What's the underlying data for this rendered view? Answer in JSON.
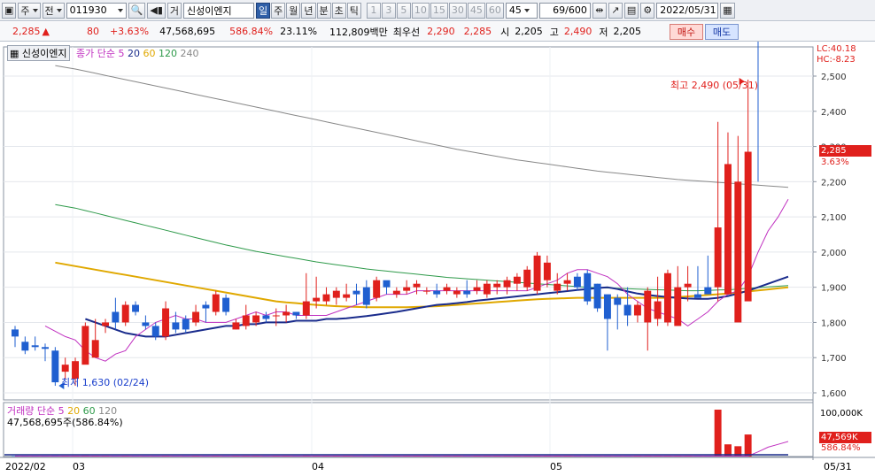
{
  "toolbar": {
    "market_label": "주",
    "type_label": "전",
    "code": "011930",
    "chart_type_label": "거",
    "name": "신성이엔지",
    "periods": [
      "일",
      "주",
      "월",
      "년",
      "분",
      "초",
      "틱"
    ],
    "selected_period": "일",
    "intervals": [
      "1",
      "3",
      "5",
      "10",
      "15",
      "30",
      "45",
      "60"
    ],
    "interval_value": "45",
    "count": "69/600",
    "date": "2022/05/31"
  },
  "quote": {
    "price": "2,285",
    "change": "80",
    "change_pct": "+3.63%",
    "volume": "47,568,695",
    "volume_ratio": "586.84%",
    "turnover": "23.11%",
    "amount": "112,809백만",
    "best_ask_label": "최우선",
    "best_ask": "2,290",
    "best_bid": "2,285",
    "open_label": "시",
    "open": "2,205",
    "high_label": "고",
    "high": "2,490",
    "low_label": "저",
    "low": "2,205",
    "buy_label": "매수",
    "sell_label": "매도"
  },
  "price_panel": {
    "title": "신성이엔지",
    "ma_label": "종가 단순",
    "ma_periods": [
      "5",
      "20",
      "60",
      "120",
      "240"
    ],
    "lc": "LC:40.18",
    "hc": "HC:-8.23",
    "last_price": "2,285",
    "last_pct": "3.63%",
    "high_note": "최고 2,490 (05/31)",
    "low_note": "최저 1,630 (02/24)",
    "y_ticks": [
      "2,500",
      "2,400",
      "2,300",
      "2,200",
      "2,100",
      "2,000",
      "1,900",
      "1,800",
      "1,700",
      "1,600"
    ]
  },
  "volume_panel": {
    "title": "거래량",
    "ma_label": "단순",
    "ma_periods": [
      "5",
      "20",
      "60",
      "120"
    ],
    "desc": "47,568,695주(586.84%)",
    "y_tick": "100,000K",
    "last_volume": "47,569K",
    "last_pct": "586.84%"
  },
  "x_axis": {
    "labels": [
      "2022/02",
      "03",
      "04",
      "05"
    ],
    "right_label": "05/31"
  },
  "colors": {
    "up": "#e0201c",
    "down": "#1f5fd0",
    "ma5": "#c030c0",
    "ma20": "#1a2c8c",
    "ma60": "#e0a800",
    "ma120": "#2e9a4a",
    "ma240": "#888888"
  },
  "chart_data": {
    "type": "candlestick",
    "x": [
      "02/15",
      "02/16",
      "02/17",
      "02/18",
      "02/21",
      "02/22",
      "02/23",
      "02/24",
      "02/25",
      "02/28",
      "03/02",
      "03/03",
      "03/04",
      "03/07",
      "03/08",
      "03/10",
      "03/11",
      "03/14",
      "03/15",
      "03/16",
      "03/17",
      "03/18",
      "03/21",
      "03/22",
      "03/23",
      "03/24",
      "03/25",
      "03/28",
      "03/29",
      "03/30",
      "03/31",
      "04/01",
      "04/04",
      "04/05",
      "04/06",
      "04/07",
      "04/08",
      "04/11",
      "04/12",
      "04/13",
      "04/14",
      "04/15",
      "04/18",
      "04/19",
      "04/20",
      "04/21",
      "04/22",
      "04/25",
      "04/26",
      "04/27",
      "04/28",
      "04/29",
      "05/02",
      "05/03",
      "05/04",
      "05/06",
      "05/09",
      "05/10",
      "05/11",
      "05/12",
      "05/13",
      "05/16",
      "05/17",
      "05/18",
      "05/19",
      "05/20",
      "05/23",
      "05/24",
      "05/25",
      "05/26",
      "05/27",
      "05/30",
      "05/31"
    ],
    "open": [
      1780,
      1745,
      1735,
      1730,
      1720,
      1660,
      1640,
      1680,
      1700,
      1790,
      1830,
      1800,
      1850,
      1800,
      1790,
      1760,
      1800,
      1810,
      1800,
      1850,
      1830,
      1870,
      1780,
      1790,
      1800,
      1820,
      1820,
      1820,
      1830,
      1820,
      1860,
      1860,
      1870,
      1870,
      1890,
      1900,
      1870,
      1920,
      1880,
      1890,
      1900,
      1890,
      1890,
      1890,
      1880,
      1890,
      1890,
      1880,
      1900,
      1900,
      1910,
      1900,
      1890,
      1920,
      1890,
      1910,
      1930,
      1940,
      1910,
      1880,
      1870,
      1850,
      1820,
      1800,
      1810,
      1800,
      1790,
      1900,
      1880,
      1900,
      1900,
      1880,
      1800,
      1860,
      2000,
      2150,
      2200,
      2205
    ],
    "close": [
      1760,
      1720,
      1730,
      1725,
      1630,
      1680,
      1690,
      1790,
      1750,
      1800,
      1800,
      1850,
      1830,
      1790,
      1760,
      1840,
      1780,
      1780,
      1830,
      1840,
      1880,
      1830,
      1800,
      1820,
      1820,
      1810,
      1820,
      1830,
      1820,
      1860,
      1870,
      1880,
      1890,
      1880,
      1880,
      1850,
      1920,
      1900,
      1890,
      1900,
      1910,
      1890,
      1880,
      1900,
      1890,
      1880,
      1900,
      1910,
      1910,
      1920,
      1930,
      1950,
      1990,
      1970,
      1910,
      1920,
      1900,
      1860,
      1840,
      1810,
      1850,
      1820,
      1850,
      1890,
      1860,
      1940,
      1900,
      1910,
      1870,
      1880,
      2070,
      2250,
      2200,
      2285
    ],
    "high": [
      1790,
      1760,
      1760,
      1740,
      1730,
      1700,
      1700,
      1800,
      1810,
      1810,
      1870,
      1860,
      1860,
      1820,
      1800,
      1860,
      1830,
      1820,
      1850,
      1860,
      1890,
      1880,
      1810,
      1850,
      1830,
      1830,
      1840,
      1850,
      1830,
      1940,
      1930,
      1900,
      1900,
      1910,
      1910,
      1920,
      1930,
      1910,
      1900,
      1920,
      1920,
      1900,
      1910,
      1910,
      1900,
      1920,
      1920,
      1920,
      1920,
      1930,
      1940,
      1960,
      2000,
      1990,
      1940,
      1940,
      1940,
      1950,
      1910,
      1870,
      1880,
      1900,
      1860,
      1900,
      1930,
      1950,
      1960,
      1960,
      1960,
      1990,
      2370,
      2340,
      2330,
      2490
    ],
    "low": [
      1730,
      1710,
      1720,
      1690,
      1620,
      1640,
      1620,
      1740,
      1700,
      1770,
      1780,
      1790,
      1820,
      1780,
      1750,
      1750,
      1770,
      1770,
      1790,
      1800,
      1820,
      1820,
      1780,
      1780,
      1790,
      1800,
      1790,
      1800,
      1810,
      1810,
      1840,
      1850,
      1850,
      1860,
      1850,
      1840,
      1860,
      1880,
      1870,
      1880,
      1880,
      1880,
      1870,
      1880,
      1870,
      1870,
      1880,
      1870,
      1880,
      1880,
      1890,
      1890,
      1880,
      1900,
      1880,
      1890,
      1890,
      1850,
      1830,
      1720,
      1780,
      1790,
      1800,
      1720,
      1790,
      1790,
      1800,
      1860,
      1870,
      1880,
      1860,
      1990,
      2150,
      2180,
      2200
    ],
    "ma5": [
      1790,
      1775,
      1760,
      1750,
      1720,
      1700,
      1690,
      1710,
      1720,
      1760,
      1780,
      1800,
      1810,
      1820,
      1810,
      1810,
      1800,
      1800,
      1800,
      1810,
      1820,
      1830,
      1820,
      1830,
      1830,
      1820,
      1820,
      1820,
      1820,
      1830,
      1840,
      1850,
      1860,
      1870,
      1880,
      1880,
      1880,
      1890,
      1890,
      1890,
      1890,
      1890,
      1890,
      1890,
      1890,
      1890,
      1890,
      1890,
      1890,
      1900,
      1910,
      1920,
      1940,
      1950,
      1950,
      1940,
      1930,
      1910,
      1880,
      1860,
      1840,
      1830,
      1820,
      1810,
      1790,
      1810,
      1830,
      1860,
      1880,
      1890,
      1930,
      2000,
      2060,
      2100,
      2150
    ],
    "ma20": [
      1810,
      1800,
      1790,
      1780,
      1770,
      1765,
      1760,
      1760,
      1760,
      1765,
      1770,
      1775,
      1780,
      1785,
      1790,
      1790,
      1795,
      1795,
      1800,
      1800,
      1800,
      1805,
      1805,
      1805,
      1810,
      1810,
      1812,
      1815,
      1818,
      1822,
      1826,
      1830,
      1835,
      1840,
      1845,
      1850,
      1852,
      1855,
      1858,
      1862,
      1865,
      1868,
      1871,
      1874,
      1877,
      1880,
      1883,
      1886,
      1889,
      1892,
      1895,
      1898,
      1900,
      1895,
      1888,
      1882,
      1878,
      1875,
      1872,
      1870,
      1868,
      1867,
      1867,
      1870,
      1875,
      1882,
      1890,
      1900,
      1910,
      1920,
      1930
    ],
    "ma60": [
      1970,
      1965,
      1960,
      1955,
      1950,
      1945,
      1940,
      1935,
      1930,
      1925,
      1920,
      1915,
      1910,
      1905,
      1900,
      1895,
      1890,
      1885,
      1880,
      1875,
      1870,
      1865,
      1860,
      1857,
      1855,
      1852,
      1850,
      1848,
      1846,
      1845,
      1844,
      1843,
      1843,
      1843,
      1843,
      1843,
      1844,
      1845,
      1846,
      1848,
      1850,
      1852,
      1854,
      1856,
      1858,
      1860,
      1862,
      1864,
      1866,
      1867,
      1868,
      1869,
      1870,
      1870,
      1870,
      1870,
      1870,
      1870,
      1870,
      1870,
      1870,
      1870,
      1872,
      1874,
      1876,
      1878,
      1880,
      1882,
      1885,
      1888,
      1891,
      1894,
      1897,
      1900
    ],
    "ma120": [
      2135,
      2130,
      2125,
      2118,
      2111,
      2104,
      2097,
      2090,
      2083,
      2076,
      2069,
      2062,
      2055,
      2048,
      2041,
      2034,
      2027,
      2020,
      2014,
      2008,
      2002,
      1997,
      1992,
      1987,
      1982,
      1977,
      1972,
      1968,
      1964,
      1960,
      1956,
      1952,
      1949,
      1946,
      1943,
      1940,
      1937,
      1934,
      1931,
      1928,
      1926,
      1924,
      1922,
      1920,
      1918,
      1916,
      1914,
      1912,
      1910,
      1908,
      1906,
      1904,
      1902,
      1900,
      1899,
      1898,
      1897,
      1896,
      1895,
      1894,
      1893,
      1892,
      1891,
      1890,
      1890,
      1891,
      1892,
      1893,
      1895,
      1897,
      1899,
      1901,
      1903,
      1905
    ],
    "ma240": [
      2530,
      2525,
      2520,
      2514,
      2508,
      2502,
      2496,
      2490,
      2484,
      2478,
      2472,
      2466,
      2460,
      2454,
      2448,
      2442,
      2436,
      2430,
      2424,
      2418,
      2412,
      2406,
      2400,
      2394,
      2388,
      2382,
      2376,
      2370,
      2364,
      2358,
      2352,
      2346,
      2340,
      2334,
      2328,
      2322,
      2316,
      2310,
      2304,
      2298,
      2292,
      2287,
      2282,
      2277,
      2272,
      2267,
      2262,
      2258,
      2254,
      2250,
      2246,
      2242,
      2238,
      2234,
      2230,
      2227,
      2224,
      2221,
      2218,
      2215,
      2212,
      2209,
      2206,
      2204,
      2202,
      2200,
      2198,
      2196,
      2194,
      2192,
      2190,
      2188,
      2186,
      2184
    ],
    "volume_pct": [
      1,
      1,
      1,
      1,
      2,
      1,
      1,
      2,
      1,
      1,
      1,
      1,
      1,
      1,
      1,
      1,
      1,
      1,
      1,
      1,
      1,
      1,
      1,
      1,
      1,
      1,
      1,
      1,
      1,
      2,
      1,
      1,
      1,
      1,
      1,
      1,
      1,
      1,
      1,
      1,
      1,
      1,
      1,
      1,
      1,
      1,
      1,
      1,
      1,
      1,
      1,
      1,
      1,
      1,
      1,
      1,
      1,
      1,
      1,
      1,
      1,
      1,
      1,
      1,
      1,
      1,
      1,
      1,
      1,
      1,
      100,
      26,
      22,
      47
    ],
    "ylim": [
      1580,
      2560
    ]
  }
}
